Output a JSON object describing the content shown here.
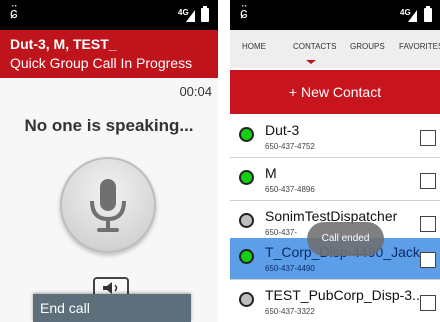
{
  "left_screen": {
    "status_bar": {
      "network": "4G"
    },
    "caller": "Dut-3, M, TEST_",
    "call_status": "Quick Group Call In Progress",
    "timer": "00:04",
    "speaking_status": "No one is speaking...",
    "end_call_label": "End call",
    "colors": {
      "header": "#c0141c",
      "end_call_bg": "#5c6f7b"
    }
  },
  "right_screen": {
    "status_bar": {
      "network": "4G"
    },
    "tabs": [
      "HOME",
      "CONTACTS",
      "GROUPS",
      "FAVORITES"
    ],
    "active_tab": "CONTACTS",
    "new_contact_label": "+ New Contact",
    "contacts": [
      {
        "name": "Dut-3",
        "phone": "650-437-4752",
        "status": "online"
      },
      {
        "name": "M",
        "phone": "650-437-4896",
        "status": "online"
      },
      {
        "name": "SonimTestDispatcher",
        "phone": "650-437-",
        "status": "offline"
      },
      {
        "name": "T_Corp_Disp-4490_Jack",
        "phone": "650-437-4490",
        "status": "online",
        "selected": true
      },
      {
        "name": "TEST_PubCorp_Disp-3..",
        "phone": "650-437-3322",
        "status": "offline"
      }
    ],
    "toast": "Call ended",
    "colors": {
      "accent": "#c8141c",
      "online": "#10d010",
      "offline": "#bdbdbd",
      "selected_row": "#5c9ee8"
    }
  }
}
